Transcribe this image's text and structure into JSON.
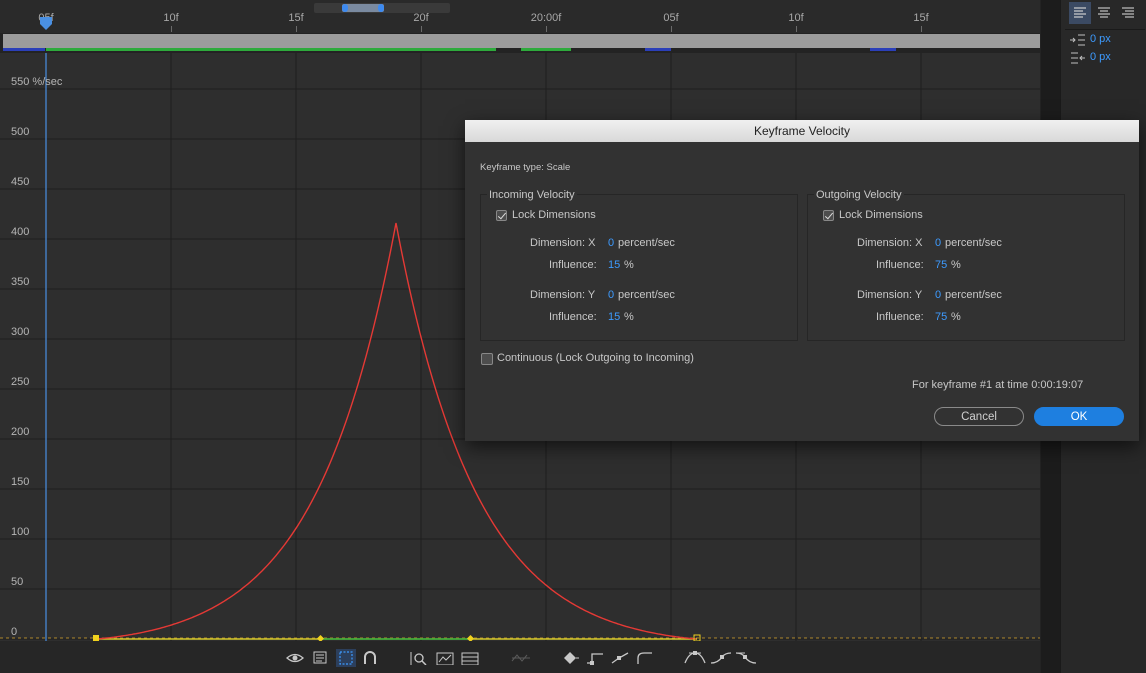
{
  "timeline": {
    "ruler_labels": [
      "05f",
      "10f",
      "15f",
      "20f",
      "20:00f",
      "05f",
      "10f",
      "15f"
    ],
    "y_axis_labels": [
      "550 %/sec",
      "500",
      "450",
      "400",
      "350",
      "300",
      "250",
      "200",
      "150",
      "100",
      "50",
      "0"
    ]
  },
  "right_panel": {
    "indent_before": "0 px",
    "indent_after": "0 px"
  },
  "dialog": {
    "title": "Keyframe Velocity",
    "keyframe_type": "Keyframe type: Scale",
    "incoming": {
      "title": "Incoming Velocity",
      "lock_label": "Lock Dimensions",
      "lock_checked": true,
      "dim_x_label": "Dimension: X",
      "dim_x_value": "0",
      "dim_x_unit": "percent/sec",
      "infl_x_label": "Influence:",
      "infl_x_value": "15",
      "infl_x_unit": "%",
      "dim_y_label": "Dimension: Y",
      "dim_y_value": "0",
      "dim_y_unit": "percent/sec",
      "infl_y_label": "Influence:",
      "infl_y_value": "15",
      "infl_y_unit": "%"
    },
    "outgoing": {
      "title": "Outgoing Velocity",
      "lock_label": "Lock Dimensions",
      "lock_checked": true,
      "dim_x_label": "Dimension: X",
      "dim_x_value": "0",
      "dim_x_unit": "percent/sec",
      "infl_x_label": "Influence:",
      "infl_x_value": "75",
      "infl_x_unit": "%",
      "dim_y_label": "Dimension: Y",
      "dim_y_value": "0",
      "dim_y_unit": "percent/sec",
      "infl_y_label": "Influence:",
      "infl_y_value": "75",
      "infl_y_unit": "%"
    },
    "continuous_label": "Continuous (Lock Outgoing to Incoming)",
    "continuous_checked": false,
    "keyframe_info": "For keyframe #1 at time 0:00:19:07",
    "cancel_label": "Cancel",
    "ok_label": "OK"
  },
  "colors": {
    "curve": "#e53935",
    "accent": "#1e7fe0",
    "value_blue": "#3d9bff",
    "playhead": "#4a90e2",
    "lane_green": "#2eaa3c"
  },
  "toolbar_icons": [
    "eye-icon",
    "graph-options-icon",
    "transform-box-icon",
    "snap-icon",
    "fit-selection-icon",
    "fit-all-icon",
    "zoom-fit-icon",
    "separate-dimensions-icon",
    "keyframe-diamond-icon",
    "hold-keyframe-icon",
    "linear-keyframe-icon",
    "auto-bezier-icon",
    "easy-ease-icon",
    "ease-in-icon",
    "ease-out-icon"
  ]
}
